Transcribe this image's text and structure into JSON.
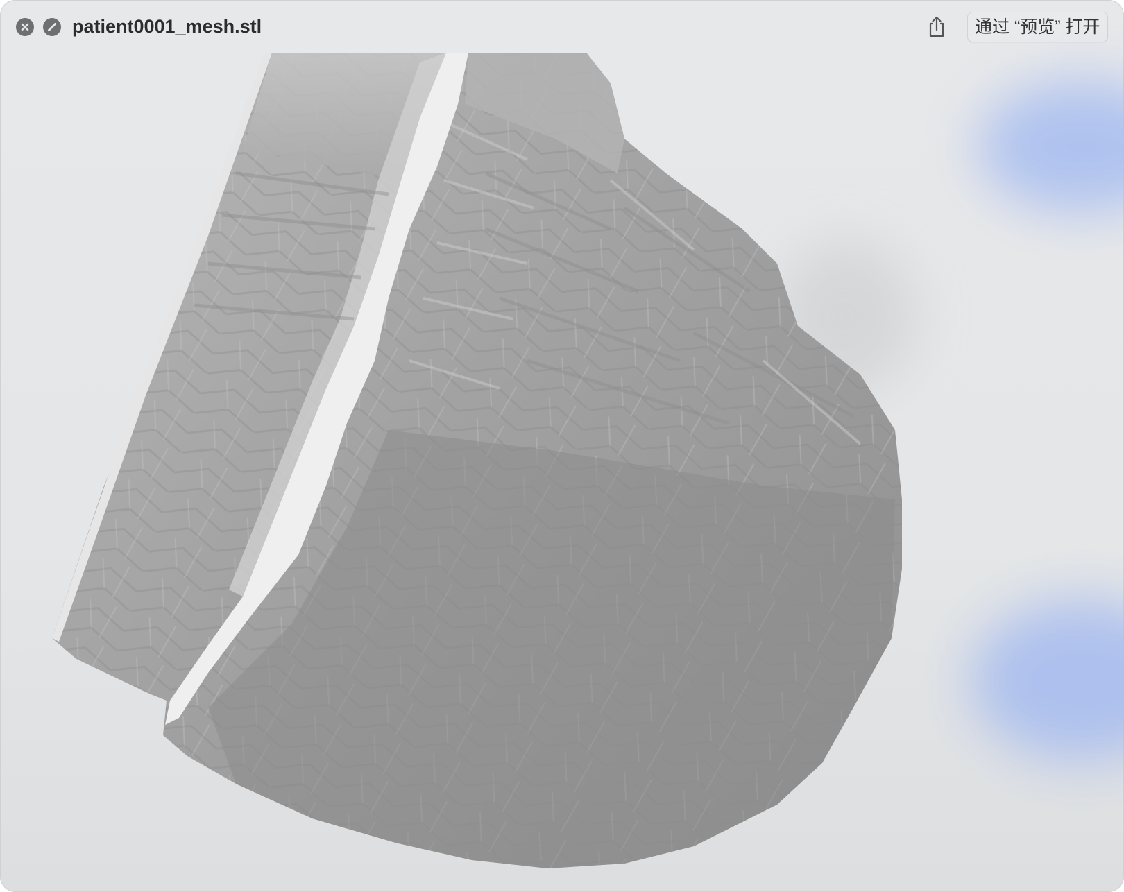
{
  "window": {
    "title": "patient0001_mesh.stl",
    "open_with_button": "通过 “预览” 打开"
  },
  "toolbar": {
    "close_icon": "close-icon",
    "markup_icon": "slash-circle-icon",
    "share_icon": "share-icon"
  },
  "viewer": {
    "content": "3d-mesh-model",
    "mesh_color": "#9a9a9a",
    "highlight_color": "#f2f2f2",
    "background_color": "#e5e7e9",
    "accent_glow_color": "#a9bdf0"
  }
}
